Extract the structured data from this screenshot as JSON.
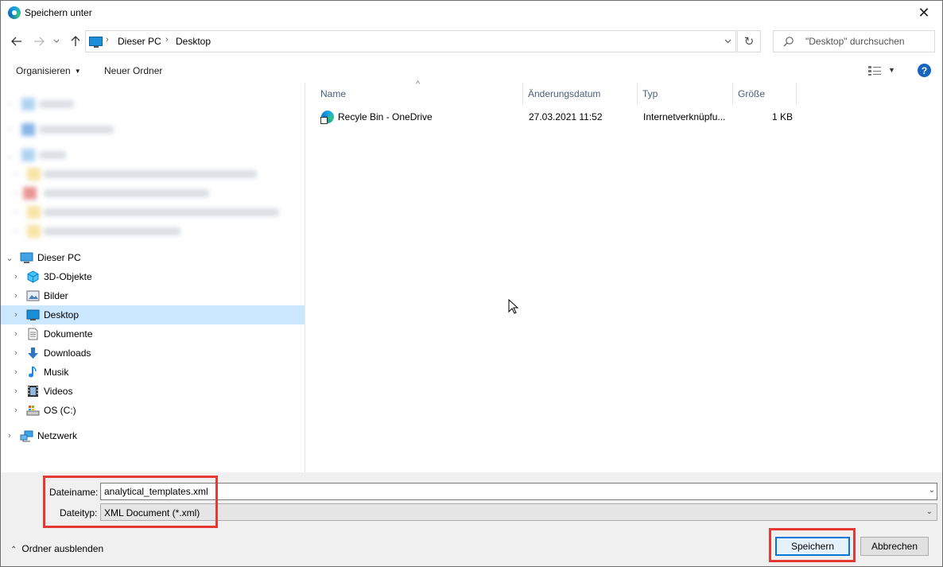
{
  "window": {
    "title": "Speichern unter",
    "close_glyph": "✕"
  },
  "address": {
    "crumbs": [
      "Dieser PC",
      "Desktop"
    ],
    "search_placeholder": "\"Desktop\" durchsuchen"
  },
  "toolbar": {
    "organize_label": "Organisieren",
    "new_folder_label": "Neuer Ordner",
    "help_label": "?"
  },
  "navpane": {
    "this_pc": "Dieser PC",
    "items": [
      {
        "label": "3D-Objekte",
        "icon": "cube-icon"
      },
      {
        "label": "Bilder",
        "icon": "pictures-icon"
      },
      {
        "label": "Desktop",
        "icon": "desktop-icon",
        "selected": true
      },
      {
        "label": "Dokumente",
        "icon": "documents-icon"
      },
      {
        "label": "Downloads",
        "icon": "downloads-icon"
      },
      {
        "label": "Musik",
        "icon": "music-icon"
      },
      {
        "label": "Videos",
        "icon": "videos-icon"
      },
      {
        "label": "OS (C:)",
        "icon": "drive-icon"
      }
    ],
    "network": "Netzwerk"
  },
  "filelist": {
    "columns": [
      "Name",
      "Änderungsdatum",
      "Typ",
      "Größe"
    ],
    "rows": [
      {
        "name": "Recyle Bin - OneDrive",
        "modified": "27.03.2021 11:52",
        "type": "Internetverknüpfu...",
        "size": "1 KB"
      }
    ]
  },
  "form": {
    "filename_label": "Dateiname:",
    "filename_value": "analytical_templates.xml",
    "filetype_label": "Dateityp:",
    "filetype_value": "XML Document (*.xml)"
  },
  "footer": {
    "hide_folders_label": "Ordner ausblenden",
    "save_label": "Speichern",
    "cancel_label": "Abbrechen"
  },
  "colors": {
    "selection": "#cce8ff",
    "accent": "#0078d7",
    "highlight": "#e53935"
  }
}
